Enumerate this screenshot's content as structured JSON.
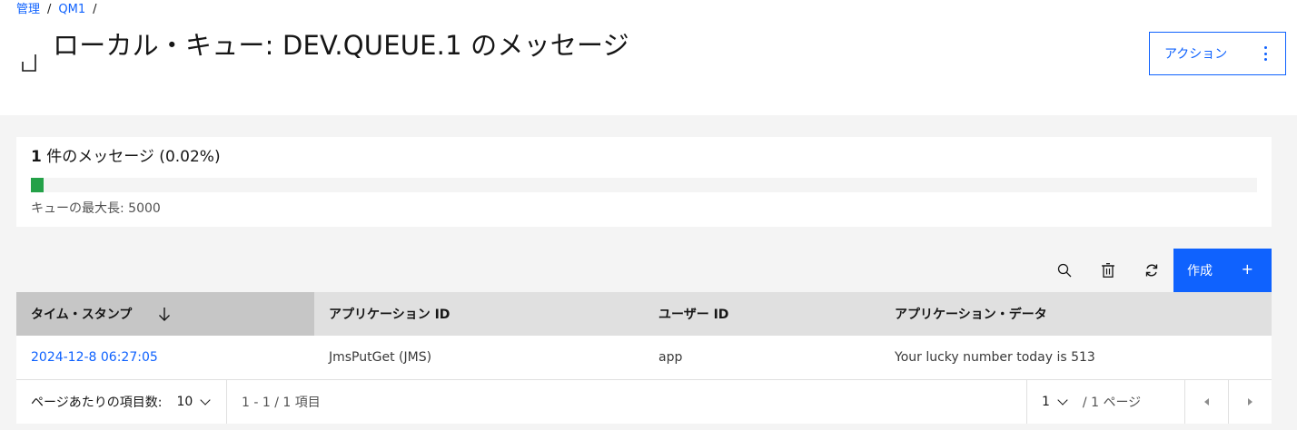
{
  "breadcrumb": {
    "items": [
      "管理",
      "QM1"
    ],
    "separator": "/"
  },
  "header": {
    "title": "ローカル・キュー: DEV.QUEUE.1 のメッセージ",
    "action_label": "アクション"
  },
  "summary": {
    "count": "1",
    "count_suffix": " 件のメッセージ (0.02%)",
    "progress_percent": 0.02,
    "max_depth_label": "キューの最大長: 5000"
  },
  "toolbar": {
    "create_label": "作成",
    "create_icon": "+"
  },
  "table": {
    "columns": [
      "タイム・スタンプ",
      "アプリケーション ID",
      "ユーザー ID",
      "アプリケーション・データ"
    ],
    "sorted_column": "タイム・スタンプ",
    "sort_direction": "descending",
    "rows": [
      {
        "timestamp": "2024-12-8 06:27:05",
        "app_id": "JmsPutGet (JMS)",
        "user_id": "app",
        "app_data": "Your lucky number today is 513"
      }
    ]
  },
  "pagination": {
    "items_per_page_label": "ページあたりの項目数:",
    "items_per_page": "10",
    "range": "1 - 1 / 1 項目",
    "current_page": "1",
    "total_pages": "/ 1 ページ"
  },
  "colors": {
    "accent": "#0f62fe",
    "progress": "#24a148",
    "header_bg": "#e0e0e0",
    "sorted_bg": "#c6c6c6",
    "page_bg": "#f4f4f4"
  }
}
